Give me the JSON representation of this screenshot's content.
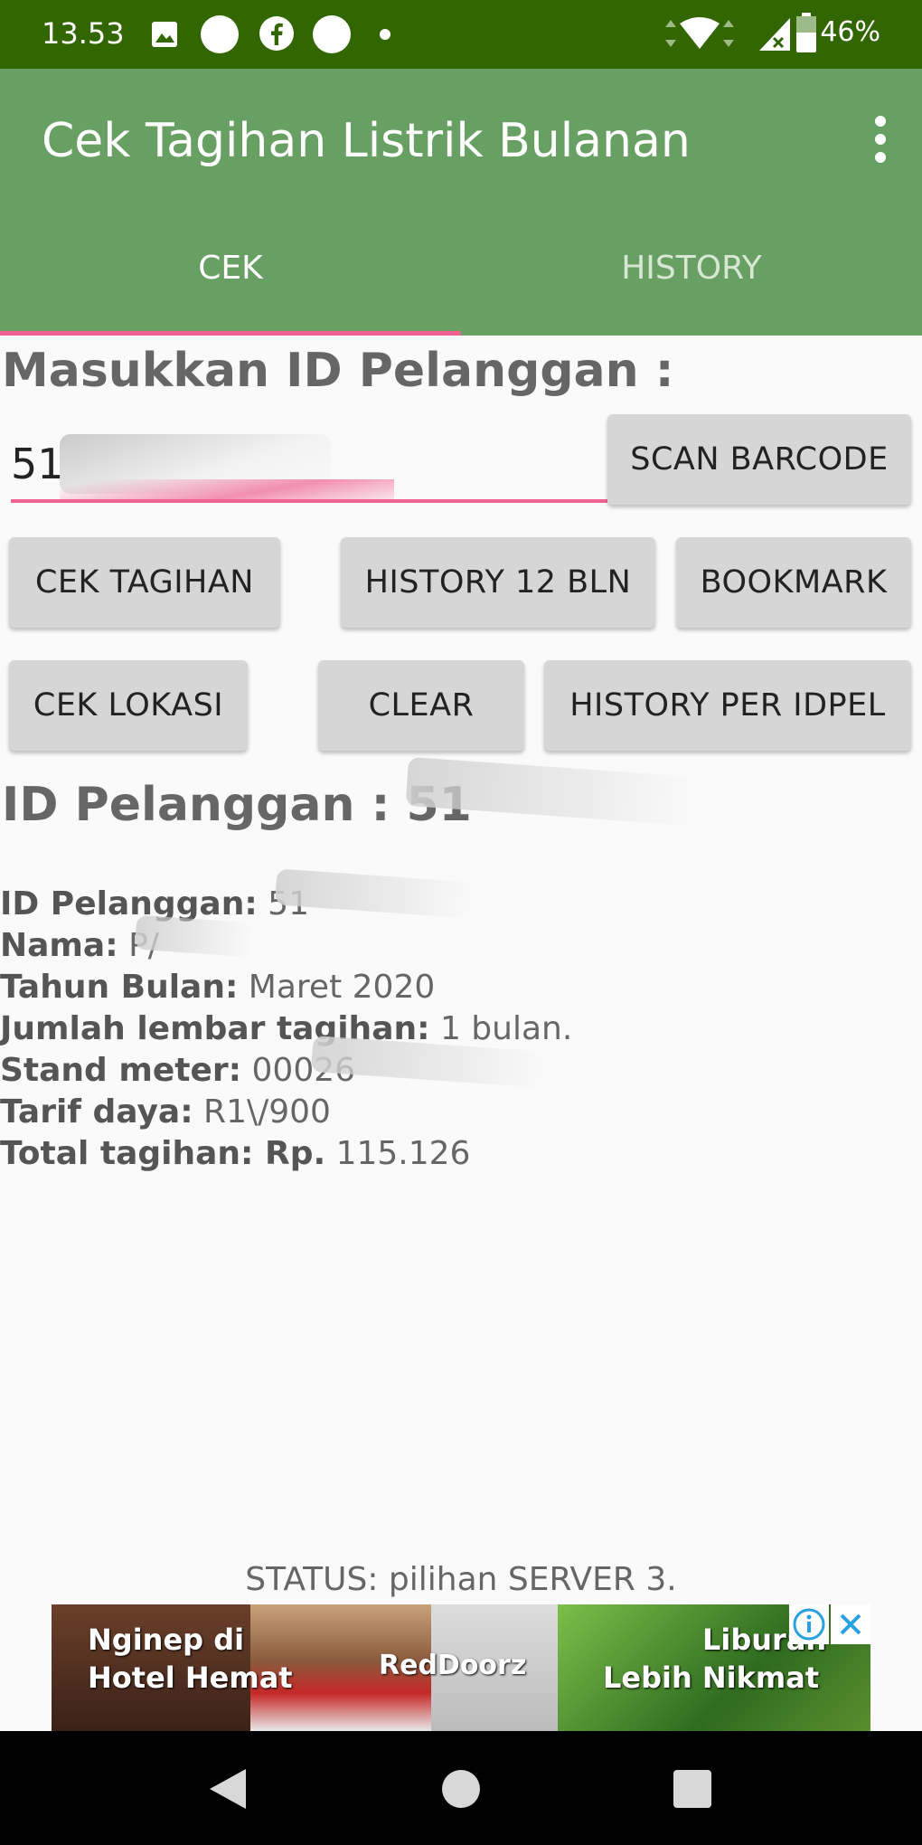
{
  "status_bar": {
    "time": "13.53",
    "battery": "46%"
  },
  "app_bar": {
    "title": "Cek Tagihan Listrik Bulanan"
  },
  "tabs": [
    {
      "label": "CEK",
      "active": true
    },
    {
      "label": "HISTORY",
      "active": false
    }
  ],
  "form": {
    "prompt": "Masukkan ID Pelanggan :",
    "id_value": "51"
  },
  "buttons": {
    "scan": "SCAN BARCODE",
    "cek_tagihan": "CEK TAGIHAN",
    "history12": "HISTORY 12 BLN",
    "bookmark": "BOOKMARK",
    "cek_lokasi": "CEK LOKASI",
    "clear": "CLEAR",
    "history_idpel": "HISTORY PER IDPEL"
  },
  "result": {
    "heading": "ID Pelanggan : 51",
    "rows": [
      {
        "label": "ID Pelanggan:",
        "value": " 51"
      },
      {
        "label": "Nama:",
        "value": " P/"
      },
      {
        "label": "Tahun Bulan:",
        "value": " Maret 2020"
      },
      {
        "label": "Jumlah lembar tagihan:",
        "value": " 1 bulan."
      },
      {
        "label": "Stand meter:",
        "value": " 00026"
      },
      {
        "label": "Tarif daya:",
        "value": " R1\\/900"
      },
      {
        "label": "Total tagihan: Rp.",
        "value": " 115.126"
      }
    ]
  },
  "status": "STATUS: pilihan SERVER 3.",
  "ad": {
    "left_text_1": "Nginep di",
    "left_text_2": "Hotel Hemat",
    "brand": "RedDoorz",
    "right_text_1": "Liburan",
    "right_text_2": "Lebih Nikmat"
  },
  "colors": {
    "status_bar": "#326600",
    "app_bar": "#689f63",
    "accent": "#f06292",
    "button": "#d6d6d6"
  }
}
